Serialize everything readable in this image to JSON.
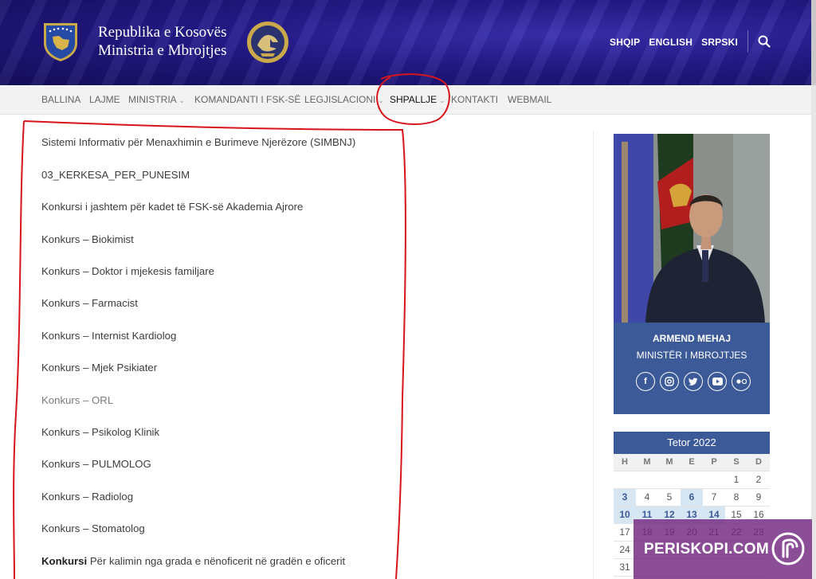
{
  "header": {
    "title_line1": "Republika e Kosovës",
    "title_line2": "Ministria e Mbrojtjes",
    "languages": [
      "SHQIP",
      "ENGLISH",
      "SRPSKI"
    ],
    "search_icon": "search-icon"
  },
  "nav": {
    "items": [
      {
        "label": "BALLINA"
      },
      {
        "label": "LAJME"
      },
      {
        "label": "MINISTRIA"
      },
      {
        "label": "KOMANDANTI I FSK-SË"
      },
      {
        "label": "LEGJISLACIONI"
      },
      {
        "label": "SHPALLJE"
      },
      {
        "label": "KONTAKTI"
      },
      {
        "label": "WEBMAIL"
      }
    ]
  },
  "main": {
    "items": [
      {
        "text": "Sistemi Informativ për Menaxhimin e Burimeve Njerëzore (SIMBNJ)"
      },
      {
        "text": "03_KERKESA_PER_PUNESIM"
      },
      {
        "text": "Konkursi i jashtem për kadet të FSK-së Akademia Ajrore"
      },
      {
        "text": "Konkurs – Biokimist"
      },
      {
        "text": "Konkurs – Doktor i mjekesis familjare"
      },
      {
        "text": "Konkurs – Farmacist"
      },
      {
        "text": "Konkurs – Internist Kardiolog"
      },
      {
        "text": "Konkurs – Mjek Psikiater"
      },
      {
        "text": "Konkurs – ORL"
      },
      {
        "text": "Konkurs – Psikolog Klinik"
      },
      {
        "text": "Konkurs – PULMOLOG"
      },
      {
        "text": "Konkurs – Radiolog"
      },
      {
        "text": "Konkurs – Stomatolog"
      },
      {
        "bold": "Konkursi",
        "text": " Për kalimin nga grada e nënoficerit në gradën e oficerit"
      }
    ]
  },
  "minister": {
    "name": "ARMEND MEHAJ",
    "title": "MINISTËR I MBROJTJES",
    "socials": [
      "facebook-icon",
      "instagram-icon",
      "twitter-icon",
      "youtube-icon",
      "flickr-icon"
    ]
  },
  "calendar": {
    "month": "Tetor 2022",
    "weekdays": [
      "H",
      "M",
      "M",
      "E",
      "P",
      "S",
      "D"
    ],
    "rows": [
      [
        "",
        "",
        "",
        "",
        "",
        "1",
        "2"
      ],
      [
        "3",
        "4",
        "5",
        "6",
        "7",
        "8",
        "9"
      ],
      [
        "10",
        "11",
        "12",
        "13",
        "14",
        "15",
        "16"
      ],
      [
        "17",
        "18",
        "19",
        "20",
        "21",
        "22",
        "23"
      ],
      [
        "24",
        "",
        "",
        "",
        "",
        "",
        ""
      ],
      [
        "31",
        "",
        "",
        "",
        "",
        "",
        ""
      ]
    ],
    "highlighted": [
      "3",
      "6",
      "10",
      "11",
      "12",
      "13",
      "14"
    ]
  },
  "watermark": {
    "text": "PERISKOPI.COM",
    "color": "#732680"
  },
  "colors": {
    "header_bg": "#241a8a",
    "accent": "#3c5a97",
    "annotation": "#d8141c"
  }
}
